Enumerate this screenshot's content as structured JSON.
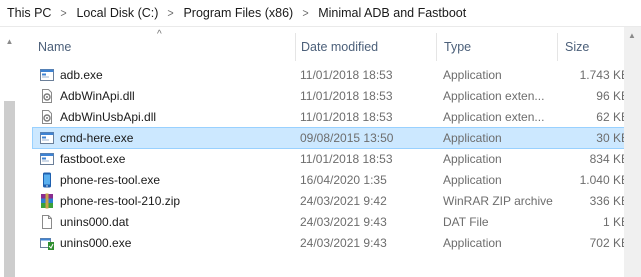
{
  "breadcrumb": [
    "This PC",
    "Local Disk (C:)",
    "Program Files (x86)",
    "Minimal ADB and Fastboot"
  ],
  "columns": {
    "name": "Name",
    "date": "Date modified",
    "type": "Type",
    "size": "Size"
  },
  "files": [
    {
      "name": "adb.exe",
      "date": "11/01/2018 18:53",
      "type": "Application",
      "size": "1.743 KB",
      "icon": "exe-window-icon"
    },
    {
      "name": "AdbWinApi.dll",
      "date": "11/01/2018 18:53",
      "type": "Application exten...",
      "size": "96 KB",
      "icon": "dll-gear-icon"
    },
    {
      "name": "AdbWinUsbApi.dll",
      "date": "11/01/2018 18:53",
      "type": "Application exten...",
      "size": "62 KB",
      "icon": "dll-gear-icon"
    },
    {
      "name": "cmd-here.exe",
      "date": "09/08/2015 13:50",
      "type": "Application",
      "size": "30 KB",
      "icon": "exe-window-icon",
      "selected": true
    },
    {
      "name": "fastboot.exe",
      "date": "11/01/2018 18:53",
      "type": "Application",
      "size": "834 KB",
      "icon": "exe-window-icon"
    },
    {
      "name": "phone-res-tool.exe",
      "date": "16/04/2020 1:35",
      "type": "Application",
      "size": "1.040 KB",
      "icon": "phone-app-icon"
    },
    {
      "name": "phone-res-tool-210.zip",
      "date": "24/03/2021 9:42",
      "type": "WinRAR ZIP archive",
      "size": "336 KB",
      "icon": "winrar-archive-icon"
    },
    {
      "name": "unins000.dat",
      "date": "24/03/2021 9:43",
      "type": "DAT File",
      "size": "1 KB",
      "icon": "blank-file-icon"
    },
    {
      "name": "unins000.exe",
      "date": "24/03/2021 9:43",
      "type": "Application",
      "size": "702 KB",
      "icon": "uninstaller-icon"
    }
  ]
}
